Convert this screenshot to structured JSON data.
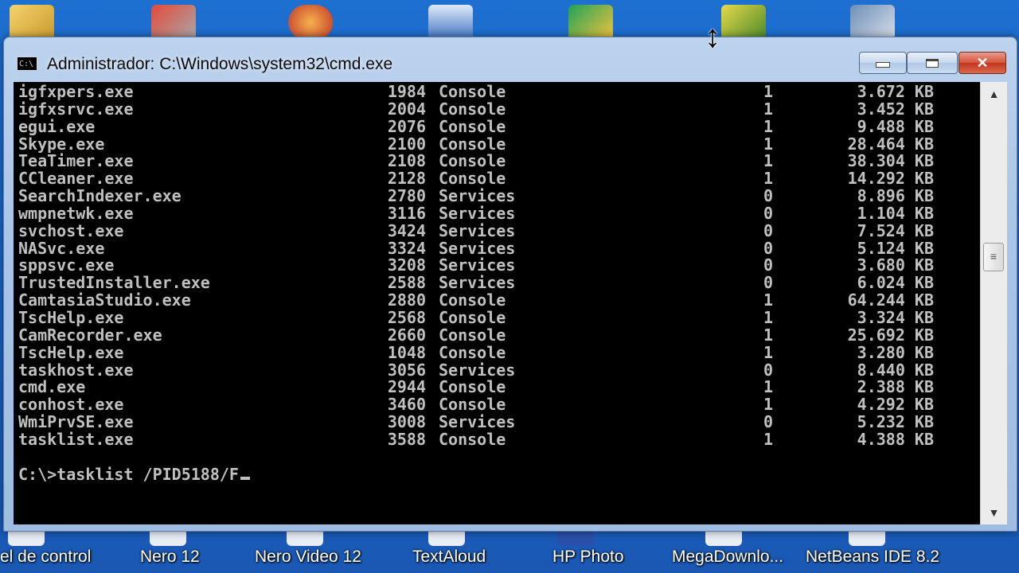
{
  "window": {
    "title": "Administrador: C:\\Windows\\system32\\cmd.exe",
    "icon": "cmd-icon",
    "icon_text": "C:\\"
  },
  "controls": {
    "minimize": "minimize-icon",
    "maximize": "maximize-icon",
    "close": "✕"
  },
  "console": {
    "rows": [
      [
        "igfxpers.exe",
        "1984",
        "Console",
        "1",
        "3.672 KB"
      ],
      [
        "igfxsrvc.exe",
        "2004",
        "Console",
        "1",
        "3.452 KB"
      ],
      [
        "egui.exe",
        "2076",
        "Console",
        "1",
        "9.488 KB"
      ],
      [
        "Skype.exe",
        "2100",
        "Console",
        "1",
        "28.464 KB"
      ],
      [
        "TeaTimer.exe",
        "2108",
        "Console",
        "1",
        "38.304 KB"
      ],
      [
        "CCleaner.exe",
        "2128",
        "Console",
        "1",
        "14.292 KB"
      ],
      [
        "SearchIndexer.exe",
        "2780",
        "Services",
        "0",
        "8.896 KB"
      ],
      [
        "wmpnetwk.exe",
        "3116",
        "Services",
        "0",
        "1.104 KB"
      ],
      [
        "svchost.exe",
        "3424",
        "Services",
        "0",
        "7.524 KB"
      ],
      [
        "NASvc.exe",
        "3324",
        "Services",
        "0",
        "5.124 KB"
      ],
      [
        "sppsvc.exe",
        "3208",
        "Services",
        "0",
        "3.680 KB"
      ],
      [
        "TrustedInstaller.exe",
        "2588",
        "Services",
        "0",
        "6.024 KB"
      ],
      [
        "CamtasiaStudio.exe",
        "2880",
        "Console",
        "1",
        "64.244 KB"
      ],
      [
        "TscHelp.exe",
        "2568",
        "Console",
        "1",
        "3.324 KB"
      ],
      [
        "CamRecorder.exe",
        "2660",
        "Console",
        "1",
        "25.692 KB"
      ],
      [
        "TscHelp.exe",
        "1048",
        "Console",
        "1",
        "3.280 KB"
      ],
      [
        "taskhost.exe",
        "3056",
        "Services",
        "0",
        "8.440 KB"
      ],
      [
        "cmd.exe",
        "2944",
        "Console",
        "1",
        "2.388 KB"
      ],
      [
        "conhost.exe",
        "3460",
        "Console",
        "1",
        "4.292 KB"
      ],
      [
        "WmiPrvSE.exe",
        "3008",
        "Services",
        "0",
        "5.232 KB"
      ],
      [
        "tasklist.exe",
        "3588",
        "Console",
        "1",
        "4.388 KB"
      ]
    ],
    "prompt": "C:\\>tasklist /PID5188/F"
  },
  "scrollbar": {
    "up": "▲",
    "down": "▼",
    "thumb": "≡"
  },
  "desktop": {
    "labels": [
      "el de control",
      "Nero 12",
      "Nero Video 12",
      "TextAloud",
      "HP Photo",
      "MegaDownlo...",
      "NetBeans IDE 8.2"
    ]
  },
  "cursor": "↕"
}
